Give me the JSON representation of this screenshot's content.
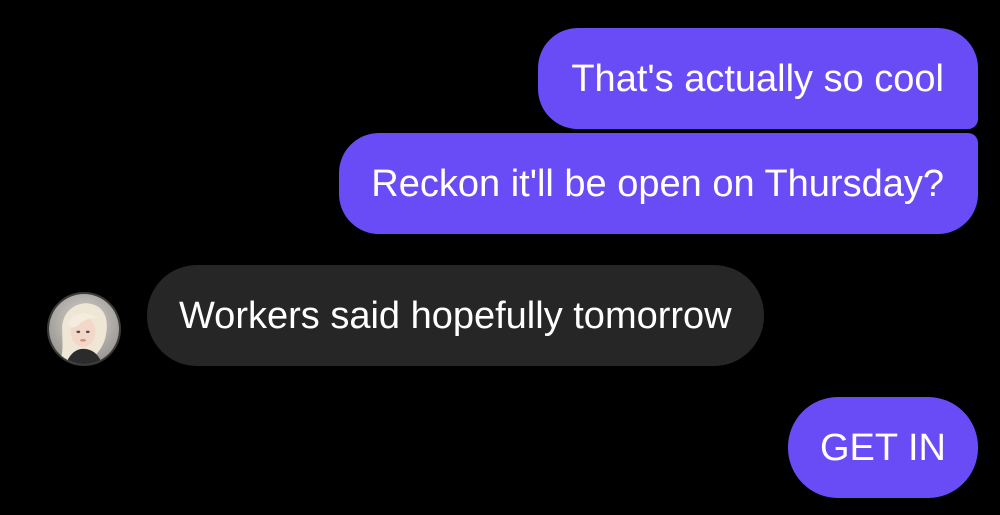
{
  "messages": [
    {
      "direction": "outgoing",
      "text": "That's actually so cool"
    },
    {
      "direction": "outgoing",
      "text": "Reckon it'll be open on Thursday?"
    },
    {
      "direction": "incoming",
      "text": "Workers said hopefully tomorrow"
    },
    {
      "direction": "outgoing",
      "text": "GET IN"
    }
  ],
  "colors": {
    "background": "#000000",
    "outgoing_bubble": "#6a4cf7",
    "incoming_bubble": "#262626",
    "text": "#ffffff"
  },
  "icons": {
    "sender_avatar": "avatar-photo"
  }
}
